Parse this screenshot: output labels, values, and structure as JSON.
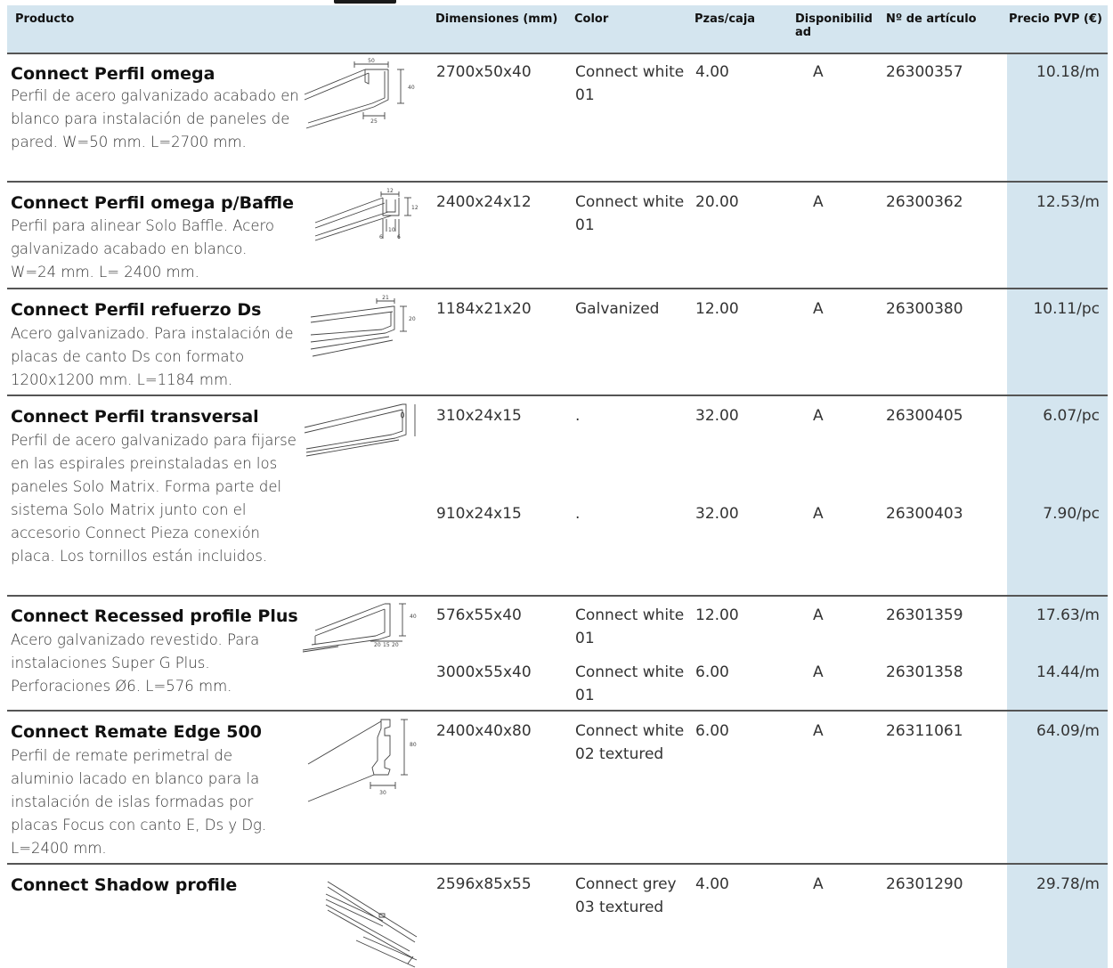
{
  "header": {
    "product": "Producto",
    "dims": "Dimensiones (mm)",
    "color": "Color",
    "pcs": "Pzas/caja",
    "avail_1": "Disponibilid",
    "avail_2": "ad",
    "article": "Nº de artículo",
    "price": "Precio PVP (€)"
  },
  "products": [
    {
      "name": "Connect Perfil omega",
      "desc": "Perfil de acero galvanizado acabado en blanco para instalación de paneles de pared. W=50 mm. L=2700 mm.",
      "drawing": {
        "icon": "omega-profile-drawing",
        "labels": [
          "50",
          "40",
          "25"
        ]
      },
      "variants": [
        {
          "dims": "2700x50x40",
          "color": "Connect white 01",
          "pcs": "4.00",
          "avail": "A",
          "article": "26300357",
          "price": "10.18/m"
        }
      ]
    },
    {
      "name": "Connect Perfil omega p/Baffle",
      "desc": "Perfil para alinear Solo Baffle. Acero galvanizado acabado en blanco. W=24 mm. L= 2400 mm.",
      "drawing": {
        "icon": "baffle-omega-profile-drawing",
        "labels": [
          "12",
          "12",
          "6",
          "10",
          "6"
        ]
      },
      "variants": [
        {
          "dims": "2400x24x12",
          "color": "Connect white 01",
          "pcs": "20.00",
          "avail": "A",
          "article": "26300362",
          "price": "12.53/m"
        }
      ]
    },
    {
      "name": "Connect Perfil refuerzo Ds",
      "desc": "Acero galvanizado. Para instalación de placas de canto Ds con formato 1200x1200 mm. L=1184 mm.",
      "drawing": {
        "icon": "reinforcement-profile-drawing",
        "labels": [
          "21",
          "20"
        ]
      },
      "variants": [
        {
          "dims": "1184x21x20",
          "color": "Galvanized",
          "pcs": "12.00",
          "avail": "A",
          "article": "26300380",
          "price": "10.11/pc"
        }
      ]
    },
    {
      "name": "Connect Perfil transversal",
      "desc": "Perfil de acero galvanizado para fijarse en las espirales preinstaladas en los paneles Solo Matrix. Forma parte del sistema Solo Matrix junto con el accesorio Connect Pieza conexión placa. Los tornillos están incluidos.",
      "drawing": {
        "icon": "transversal-profile-drawing",
        "labels": []
      },
      "variants": [
        {
          "dims": "310x24x15",
          "color": ".",
          "pcs": "32.00",
          "avail": "A",
          "article": "26300405",
          "price": "6.07/pc"
        },
        {
          "dims": "910x24x15",
          "color": ".",
          "pcs": "32.00",
          "avail": "A",
          "article": "26300403",
          "price": "7.90/pc"
        }
      ]
    },
    {
      "name": "Connect Recessed profile Plus",
      "desc": "Acero galvanizado revestido. Para instalaciones Super G Plus. Perforaciones  Ø6. L=576 mm.",
      "drawing": {
        "icon": "recessed-profile-drawing",
        "labels": [
          "40",
          "20",
          "15",
          "20"
        ]
      },
      "variants": [
        {
          "dims": "576x55x40",
          "color": "Connect white 01",
          "pcs": "12.00",
          "avail": "A",
          "article": "26301359",
          "price": "17.63/m"
        },
        {
          "dims": "3000x55x40",
          "color": "Connect white 01",
          "pcs": "6.00",
          "avail": "A",
          "article": "26301358",
          "price": "14.44/m"
        }
      ]
    },
    {
      "name": "Connect Remate Edge 500",
      "desc": "Perfil de remate perimetral de aluminio lacado en blanco para la instalación de islas formadas por placas Focus con canto E, Ds y Dg. L=2400 mm.",
      "drawing": {
        "icon": "edge-trim-profile-drawing",
        "labels": [
          "80",
          "30"
        ]
      },
      "variants": [
        {
          "dims": "2400x40x80",
          "color": "Connect white 02 textured",
          "pcs": "6.00",
          "avail": "A",
          "article": "26311061",
          "price": "64.09/m"
        }
      ]
    },
    {
      "name": "Connect Shadow profile",
      "desc": "",
      "drawing": {
        "icon": "shadow-profile-drawing",
        "labels": []
      },
      "variants": [
        {
          "dims": "2596x85x55",
          "color": "Connect grey 03 textured",
          "pcs": "4.00",
          "avail": "A",
          "article": "26301290",
          "price": "29.78/m"
        }
      ]
    }
  ]
}
